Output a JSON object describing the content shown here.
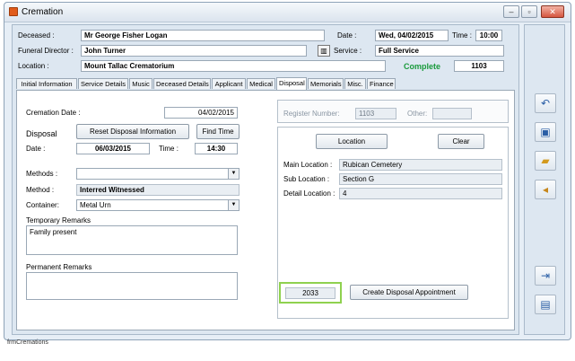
{
  "window": {
    "title": "Cremation"
  },
  "header": {
    "deceased_label": "Deceased :",
    "deceased_value": "Mr George Fisher Logan",
    "date_label": "Date :",
    "date_value": "Wed, 04/02/2015",
    "time_label": "Time :",
    "time_value": "10:00",
    "funeral_director_label": "Funeral Director :",
    "funeral_director_value": "John Turner",
    "service_label": "Service :",
    "service_value": "Full Service",
    "location_label": "Location :",
    "location_value": "Mount Tallac Crematorium",
    "status": "Complete",
    "record_number": "1103"
  },
  "tabs": [
    {
      "label": "Initial Information"
    },
    {
      "label": "Service Details"
    },
    {
      "label": "Music"
    },
    {
      "label": "Deceased Details"
    },
    {
      "label": "Applicant"
    },
    {
      "label": "Medical"
    },
    {
      "label": "Disposal"
    },
    {
      "label": "Memorials"
    },
    {
      "label": "Misc."
    },
    {
      "label": "Finance"
    }
  ],
  "disposal": {
    "cremation_date_label": "Cremation Date :",
    "cremation_date_value": "04/02/2015",
    "disposal_heading": "Disposal",
    "reset_button": "Reset Disposal Information",
    "find_time_button": "Find Time",
    "date_label": "Date :",
    "date_value": "06/03/2015",
    "time_label": "Time :",
    "time_value": "14:30",
    "methods_label": "Methods :",
    "methods_value": "",
    "method_label": "Method :",
    "method_value": "Interred Witnessed",
    "container_label": "Container:",
    "container_value": "Metal Urn",
    "temporary_remarks_label": "Temporary Remarks",
    "temporary_remarks_value": "Family present",
    "permanent_remarks_label": "Permanent Remarks",
    "permanent_remarks_value": ""
  },
  "register": {
    "register_number_label": "Register Number:",
    "register_number_value": "1103",
    "other_label": "Other:",
    "other_value": ""
  },
  "location_section": {
    "location_button": "Location",
    "clear_button": "Clear",
    "main_location_label": "Main Location :",
    "main_location_value": "Rubican Cemetery",
    "sub_location_label": "Sub Location :",
    "sub_location_value": "Section G",
    "detail_location_label": "Detail Location :",
    "detail_location_value": "4"
  },
  "appointment": {
    "number": "2033",
    "create_button": "Create Disposal Appointment"
  },
  "status_bar": {
    "text": "frmCremations"
  },
  "colors": {
    "accent_green": "#1a9a3c",
    "highlight_green": "#8fd14f"
  }
}
